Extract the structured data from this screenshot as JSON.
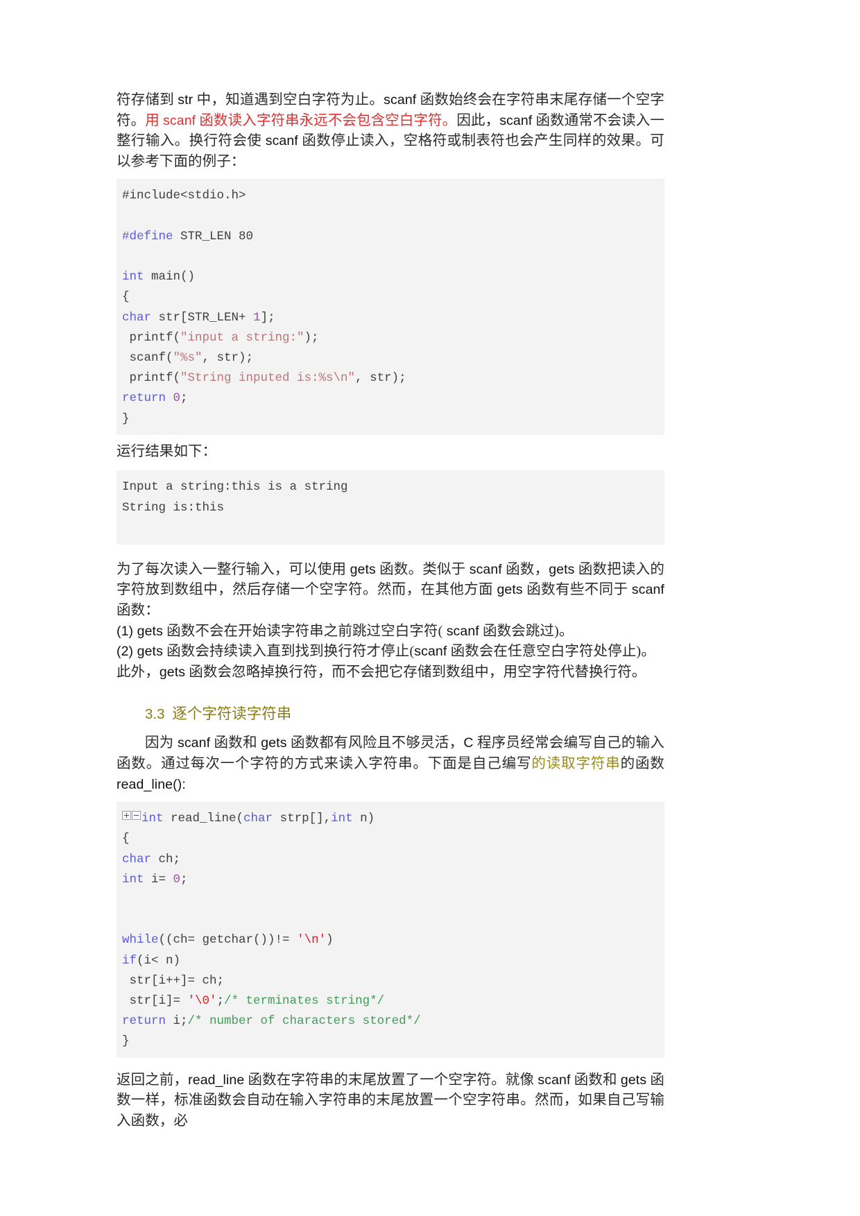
{
  "document": {
    "language": "zh-CN",
    "page_background": "#ffffff",
    "code_background": "#f3f3f3",
    "heading_color": "#8a7d17",
    "highlight_red": "#e03030"
  },
  "intro": {
    "line1_a": "符存储到 ",
    "line1_b": "str",
    "line1_c": " 中，知道遇到空白字符为止。",
    "line1_d": "scanf",
    "line1_e": " 函数始终会在字符串末尾存储一个空字符。",
    "red_a": "用 ",
    "red_b": "scanf",
    "red_c": " 函数读入字符串永远不会包含空白字符。",
    "after_red_a": "因此，",
    "after_red_b": "scanf",
    "after_red_c": " 函数通常不会读入一整行输入。换行符会使 ",
    "after_red_d": "scanf",
    "after_red_e": " 函数停止读入，空格符或制表符也会产生同样的效果。可以参考下面的例子："
  },
  "code_block_1": {
    "name": "scanf-example-code",
    "lines": [
      [
        {
          "t": "#include<stdio.h>",
          "c": "plain"
        }
      ],
      [
        {
          "t": "",
          "c": "blank"
        }
      ],
      [
        {
          "t": "#define",
          "c": "kw"
        },
        {
          "t": " STR_LEN 80",
          "c": "plain"
        }
      ],
      [
        {
          "t": "",
          "c": "blank"
        }
      ],
      [
        {
          "t": "int",
          "c": "kw"
        },
        {
          "t": " main()",
          "c": "plain"
        }
      ],
      [
        {
          "t": "{",
          "c": "plain"
        }
      ],
      [
        {
          "t": "char",
          "c": "kw"
        },
        {
          "t": " str[STR_LEN+ ",
          "c": "plain"
        },
        {
          "t": "1",
          "c": "num"
        },
        {
          "t": "];",
          "c": "plain"
        }
      ],
      [
        {
          "t": " printf(",
          "c": "plain"
        },
        {
          "t": "\"input a string:\"",
          "c": "str"
        },
        {
          "t": ");",
          "c": "plain"
        }
      ],
      [
        {
          "t": " scanf(",
          "c": "plain"
        },
        {
          "t": "\"%s\"",
          "c": "str"
        },
        {
          "t": ", str);",
          "c": "plain"
        }
      ],
      [
        {
          "t": " printf(",
          "c": "plain"
        },
        {
          "t": "\"String inputed is:%s\\n\"",
          "c": "str"
        },
        {
          "t": ", str);",
          "c": "plain"
        }
      ],
      [
        {
          "t": "return",
          "c": "kw"
        },
        {
          "t": " ",
          "c": "plain"
        },
        {
          "t": "0",
          "c": "num"
        },
        {
          "t": ";",
          "c": "plain"
        }
      ],
      [
        {
          "t": "}",
          "c": "plain"
        }
      ]
    ]
  },
  "result_label": "运行结果如下：",
  "output_block": {
    "name": "program-output",
    "lines": [
      "Input a string:this is a string",
      "String is:this"
    ]
  },
  "gets_para": {
    "p1_a": "为了每次读入一整行输入，可以使用 ",
    "p1_b": "gets",
    "p1_c": " 函数。类似于 ",
    "p1_d": "scanf",
    "p1_e": " 函数，",
    "p1_f": "gets",
    "p1_g": " 函数把读入的字符放到数组中，然后存储一个空字符。然而，在其他方面 ",
    "p1_h": "gets",
    "p1_i": " 函数有些不同于 ",
    "p1_j": "scanf",
    "p1_k": " 函数：",
    "item1_a": "(1) ",
    "item1_b": "gets",
    "item1_c": " 函数不会在开始读字符串之前跳过空白字符( ",
    "item1_d": "scanf",
    "item1_e": " 函数会跳过)。",
    "item2_a": "(2) ",
    "item2_b": "gets",
    "item2_c": " 函数会持续读入直到找到换行符才停止(",
    "item2_d": "scanf",
    "item2_e": " 函数会在任意空白字符处停止)。",
    "item3_a": "此外，",
    "item3_b": "gets",
    "item3_c": " 函数会忽略掉换行符，而不会把它存储到数组中，用空字符代替换行符。"
  },
  "section_heading": {
    "number": "3.3",
    "title": "逐个字符读字符串"
  },
  "readline_para": {
    "a": "因为 ",
    "b": "scanf",
    "c": " 函数和 ",
    "d": "gets",
    "e": " 函数都有风险且不够灵活，",
    "f": "C",
    "g": " 程序员经常会编写自己的输入函数。通过每次一个字符的方式来读入字符串。下面是自己编写",
    "h_olive": "的读取字符串",
    "i": "的函数 ",
    "j": "read_line():"
  },
  "code_block_2": {
    "name": "read-line-function-code",
    "fold_icons": [
      "expand-plus-box",
      "collapse-minus-box"
    ],
    "lines": [
      [
        {
          "t": "int",
          "c": "kw"
        },
        {
          "t": " read_line(",
          "c": "plain"
        },
        {
          "t": "char",
          "c": "kw"
        },
        {
          "t": " strp[],",
          "c": "plain"
        },
        {
          "t": "int",
          "c": "kw"
        },
        {
          "t": " n)",
          "c": "plain"
        }
      ],
      [
        {
          "t": "{",
          "c": "plain"
        }
      ],
      [
        {
          "t": "char",
          "c": "kw"
        },
        {
          "t": " ch;",
          "c": "plain"
        }
      ],
      [
        {
          "t": "int",
          "c": "kw"
        },
        {
          "t": " i= ",
          "c": "plain"
        },
        {
          "t": "0",
          "c": "num"
        },
        {
          "t": ";",
          "c": "plain"
        }
      ],
      [
        {
          "t": "",
          "c": "blank"
        }
      ],
      [
        {
          "t": "",
          "c": "blank"
        }
      ],
      [
        {
          "t": "while",
          "c": "kw"
        },
        {
          "t": "((ch= getchar())!= ",
          "c": "plain"
        },
        {
          "t": "'\\n'",
          "c": "chr"
        },
        {
          "t": ")",
          "c": "plain"
        }
      ],
      [
        {
          "t": "if",
          "c": "kw"
        },
        {
          "t": "(i< n)",
          "c": "plain"
        }
      ],
      [
        {
          "t": " str[i++]= ch;",
          "c": "plain"
        }
      ],
      [
        {
          "t": " str[i]= ",
          "c": "plain"
        },
        {
          "t": "'\\0'",
          "c": "chr"
        },
        {
          "t": ";",
          "c": "plain"
        },
        {
          "t": "/* terminates string*/",
          "c": "cmt"
        }
      ],
      [
        {
          "t": "return",
          "c": "kw"
        },
        {
          "t": " i;",
          "c": "plain"
        },
        {
          "t": "/* number of characters stored*/",
          "c": "cmt"
        }
      ],
      [
        {
          "t": "}",
          "c": "plain"
        }
      ]
    ]
  },
  "closing_para": {
    "a": "返回之前，",
    "b": "read_line",
    "c": " 函数在字符串的末尾放置了一个空字符。就像 ",
    "d": "scanf",
    "e": " 函数和 ",
    "f": "gets",
    "g": " 函数一样，标准函数会自动在输入字符串的末尾放置一个空字符串。然而，如果自己写输入函数，必"
  }
}
